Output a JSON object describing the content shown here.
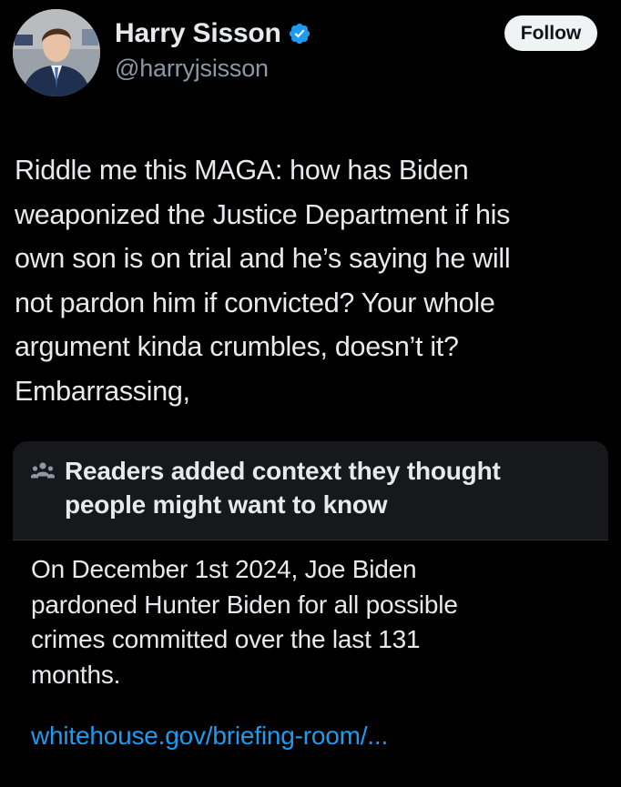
{
  "author": {
    "display_name": "Harry Sisson",
    "handle": "@harryjsisson",
    "verified": true,
    "avatar_icon": "profile-photo",
    "verified_icon": "verified-badge-icon"
  },
  "follow_label": "Follow",
  "tweet": {
    "lines": [
      "Riddle me this MAGA: how has Biden",
      "weaponized the Justice Department if his",
      "own son is on trial and he’s saying he will",
      "not pardon him if convicted? Your whole",
      "argument kinda crumbles, doesn’t it?",
      "Embarrassing,"
    ]
  },
  "community_note": {
    "icon": "community-notes-icon",
    "title_lines": [
      "Readers added context they thought",
      "people might want to know"
    ],
    "body_lines": [
      "On December 1st 2024, Joe Biden",
      "pardoned Hunter Biden for all possible",
      "crimes committed over the last 131",
      "months."
    ],
    "link_text": "whitehouse.gov/briefing-room/..."
  },
  "colors": {
    "background": "#000000",
    "text_primary": "#e7e9ea",
    "text_secondary": "#8b98a5",
    "accent_blue": "#1d9bf0",
    "note_header_bg": "#16181c",
    "follow_bg": "#eff3f4"
  }
}
